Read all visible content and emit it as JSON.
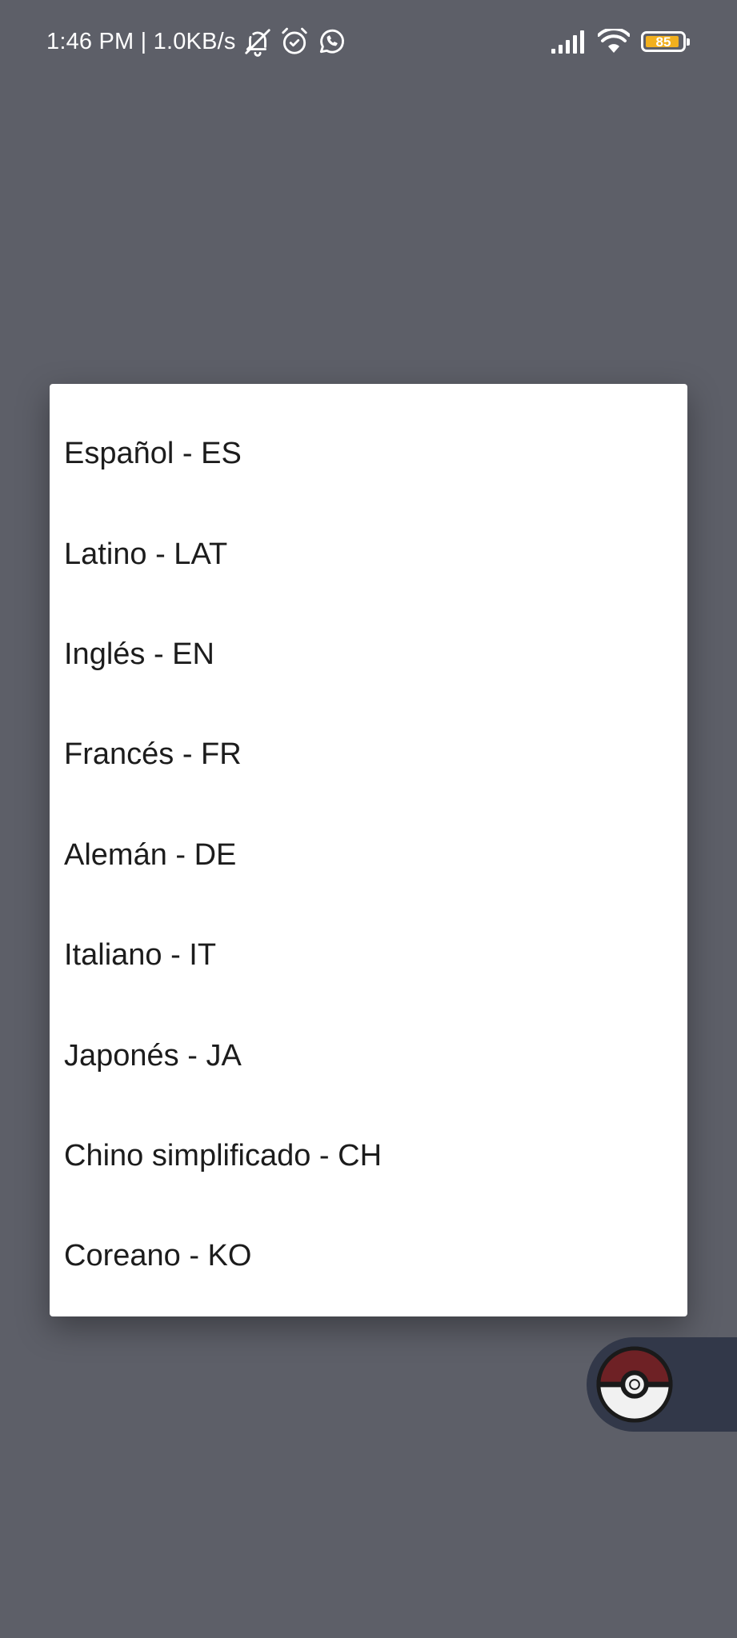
{
  "status_bar": {
    "time_speed": "1:46 PM | 1.0KB/s",
    "battery_level": "85",
    "icons": [
      "bell-off-icon",
      "alarm-icon",
      "whatsapp-icon",
      "signal-icon",
      "wifi-icon",
      "battery-icon"
    ]
  },
  "language_dialog": {
    "items": [
      {
        "label": "Español - ES"
      },
      {
        "label": "Latino - LAT"
      },
      {
        "label": "Inglés - EN"
      },
      {
        "label": "Francés - FR"
      },
      {
        "label": "Alemán - DE"
      },
      {
        "label": "Italiano - IT"
      },
      {
        "label": "Japonés - JA"
      },
      {
        "label": "Chino simplificado - CH"
      },
      {
        "label": "Coreano - KO"
      }
    ]
  },
  "floating_widget": {
    "icon": "pokeball-icon"
  },
  "colors": {
    "scrim_background": "#5d5f68",
    "dialog_background": "#ffffff",
    "text": "#1c1c1c",
    "battery_fill": "#f2b01e",
    "widget_background": "#323849",
    "pokeball_red": "#6e2125"
  }
}
